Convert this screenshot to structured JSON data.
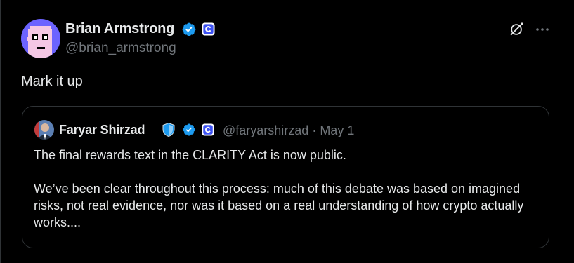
{
  "tweet": {
    "author_name": "Brian Armstrong",
    "author_handle": "@brian_armstrong",
    "text": "Mark it up",
    "verified_color": "#1d9bf0",
    "affiliate_color": "#3d52f4"
  },
  "quoted_tweet": {
    "author_name": "Faryar Shirzad",
    "author_handle": "@faryarshirzad",
    "separator": "·",
    "date": "May 1",
    "paragraphs": [
      "The final rewards text in the CLARITY Act is now public.",
      "We’ve been clear throughout this process: much of this debate was based on imagined risks, not real evidence, nor was it based on a real understanding of how crypto actually works...."
    ],
    "shield_color": "#1d9bf0"
  },
  "icons": {
    "grok": "grok-slash-circle-icon",
    "more": "more-dots-icon",
    "verified": "verified-badge-icon",
    "affiliate": "coinbase-affiliate-icon",
    "shield": "government-shield-icon"
  }
}
